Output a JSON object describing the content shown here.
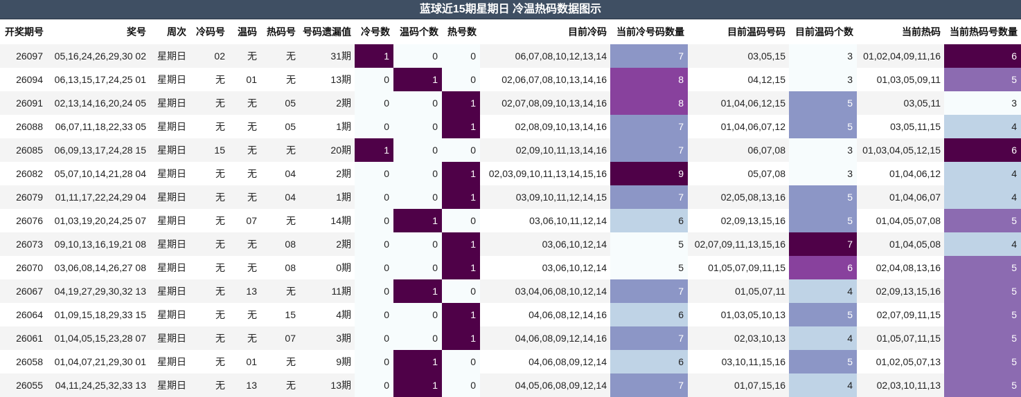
{
  "title": "蓝球近15期星期日 冷温热码数据图示",
  "headers": [
    "开奖期号",
    "奖号",
    "周次",
    "冷码号",
    "温码",
    "热码号",
    "号码遗漏值",
    "冷号数",
    "温码个数",
    "热号数",
    "目前冷码",
    "当前冷号码数量",
    "目前温码号码",
    "目前温码个数",
    "当前热码",
    "当前热码号数量"
  ],
  "colors": {
    "dark": "#4f0148",
    "purple": "#88419d",
    "med": "#8c6bb1",
    "blue": "#8c96c6",
    "light": "#bfd3e6",
    "pale": "#f7fcfd",
    "title_bg": "#3f4f63"
  },
  "rows": [
    {
      "period": "26097",
      "numbers": "05,16,24,26,29,30 02",
      "weekday": "星期日",
      "cold": "02",
      "warm": "无",
      "hot": "无",
      "miss": "31期",
      "cold_n": "1",
      "warm_n": "0",
      "hot_n": "0",
      "cur_cold": "06,07,08,10,12,13,14",
      "cur_cold_n": "7",
      "cur_warm": "03,05,15",
      "cur_warm_n": "3",
      "cur_hot": "01,02,04,09,11,16",
      "cur_hot_n": "6"
    },
    {
      "period": "26094",
      "numbers": "06,13,15,17,24,25 01",
      "weekday": "星期日",
      "cold": "无",
      "warm": "01",
      "hot": "无",
      "miss": "13期",
      "cold_n": "0",
      "warm_n": "1",
      "hot_n": "0",
      "cur_cold": "02,06,07,08,10,13,14,16",
      "cur_cold_n": "8",
      "cur_warm": "04,12,15",
      "cur_warm_n": "3",
      "cur_hot": "01,03,05,09,11",
      "cur_hot_n": "5"
    },
    {
      "period": "26091",
      "numbers": "02,13,14,16,20,24 05",
      "weekday": "星期日",
      "cold": "无",
      "warm": "无",
      "hot": "05",
      "miss": "2期",
      "cold_n": "0",
      "warm_n": "0",
      "hot_n": "1",
      "cur_cold": "02,07,08,09,10,13,14,16",
      "cur_cold_n": "8",
      "cur_warm": "01,04,06,12,15",
      "cur_warm_n": "5",
      "cur_hot": "03,05,11",
      "cur_hot_n": "3"
    },
    {
      "period": "26088",
      "numbers": "06,07,11,18,22,33 05",
      "weekday": "星期日",
      "cold": "无",
      "warm": "无",
      "hot": "05",
      "miss": "1期",
      "cold_n": "0",
      "warm_n": "0",
      "hot_n": "1",
      "cur_cold": "02,08,09,10,13,14,16",
      "cur_cold_n": "7",
      "cur_warm": "01,04,06,07,12",
      "cur_warm_n": "5",
      "cur_hot": "03,05,11,15",
      "cur_hot_n": "4"
    },
    {
      "period": "26085",
      "numbers": "06,09,13,17,24,28 15",
      "weekday": "星期日",
      "cold": "15",
      "warm": "无",
      "hot": "无",
      "miss": "20期",
      "cold_n": "1",
      "warm_n": "0",
      "hot_n": "0",
      "cur_cold": "02,09,10,11,13,14,16",
      "cur_cold_n": "7",
      "cur_warm": "06,07,08",
      "cur_warm_n": "3",
      "cur_hot": "01,03,04,05,12,15",
      "cur_hot_n": "6"
    },
    {
      "period": "26082",
      "numbers": "05,07,10,14,21,28 04",
      "weekday": "星期日",
      "cold": "无",
      "warm": "无",
      "hot": "04",
      "miss": "2期",
      "cold_n": "0",
      "warm_n": "0",
      "hot_n": "1",
      "cur_cold": "02,03,09,10,11,13,14,15,16",
      "cur_cold_n": "9",
      "cur_warm": "05,07,08",
      "cur_warm_n": "3",
      "cur_hot": "01,04,06,12",
      "cur_hot_n": "4"
    },
    {
      "period": "26079",
      "numbers": "01,11,17,22,24,29 04",
      "weekday": "星期日",
      "cold": "无",
      "warm": "无",
      "hot": "04",
      "miss": "1期",
      "cold_n": "0",
      "warm_n": "0",
      "hot_n": "1",
      "cur_cold": "03,09,10,11,12,14,15",
      "cur_cold_n": "7",
      "cur_warm": "02,05,08,13,16",
      "cur_warm_n": "5",
      "cur_hot": "01,04,06,07",
      "cur_hot_n": "4"
    },
    {
      "period": "26076",
      "numbers": "01,03,19,20,24,25 07",
      "weekday": "星期日",
      "cold": "无",
      "warm": "07",
      "hot": "无",
      "miss": "14期",
      "cold_n": "0",
      "warm_n": "1",
      "hot_n": "0",
      "cur_cold": "03,06,10,11,12,14",
      "cur_cold_n": "6",
      "cur_warm": "02,09,13,15,16",
      "cur_warm_n": "5",
      "cur_hot": "01,04,05,07,08",
      "cur_hot_n": "5"
    },
    {
      "period": "26073",
      "numbers": "09,10,13,16,19,21 08",
      "weekday": "星期日",
      "cold": "无",
      "warm": "无",
      "hot": "08",
      "miss": "2期",
      "cold_n": "0",
      "warm_n": "0",
      "hot_n": "1",
      "cur_cold": "03,06,10,12,14",
      "cur_cold_n": "5",
      "cur_warm": "02,07,09,11,13,15,16",
      "cur_warm_n": "7",
      "cur_hot": "01,04,05,08",
      "cur_hot_n": "4"
    },
    {
      "period": "26070",
      "numbers": "03,06,08,14,26,27 08",
      "weekday": "星期日",
      "cold": "无",
      "warm": "无",
      "hot": "08",
      "miss": "0期",
      "cold_n": "0",
      "warm_n": "0",
      "hot_n": "1",
      "cur_cold": "03,06,10,12,14",
      "cur_cold_n": "5",
      "cur_warm": "01,05,07,09,11,15",
      "cur_warm_n": "6",
      "cur_hot": "02,04,08,13,16",
      "cur_hot_n": "5"
    },
    {
      "period": "26067",
      "numbers": "04,19,27,29,30,32 13",
      "weekday": "星期日",
      "cold": "无",
      "warm": "13",
      "hot": "无",
      "miss": "11期",
      "cold_n": "0",
      "warm_n": "1",
      "hot_n": "0",
      "cur_cold": "03,04,06,08,10,12,14",
      "cur_cold_n": "7",
      "cur_warm": "01,05,07,11",
      "cur_warm_n": "4",
      "cur_hot": "02,09,13,15,16",
      "cur_hot_n": "5"
    },
    {
      "period": "26064",
      "numbers": "01,09,15,18,29,33 15",
      "weekday": "星期日",
      "cold": "无",
      "warm": "无",
      "hot": "15",
      "miss": "4期",
      "cold_n": "0",
      "warm_n": "0",
      "hot_n": "1",
      "cur_cold": "04,06,08,12,14,16",
      "cur_cold_n": "6",
      "cur_warm": "01,03,05,10,13",
      "cur_warm_n": "5",
      "cur_hot": "02,07,09,11,15",
      "cur_hot_n": "5"
    },
    {
      "period": "26061",
      "numbers": "01,04,05,15,23,28 07",
      "weekday": "星期日",
      "cold": "无",
      "warm": "无",
      "hot": "07",
      "miss": "3期",
      "cold_n": "0",
      "warm_n": "0",
      "hot_n": "1",
      "cur_cold": "04,06,08,09,12,14,16",
      "cur_cold_n": "7",
      "cur_warm": "02,03,10,13",
      "cur_warm_n": "4",
      "cur_hot": "01,05,07,11,15",
      "cur_hot_n": "5"
    },
    {
      "period": "26058",
      "numbers": "01,04,07,21,29,30 01",
      "weekday": "星期日",
      "cold": "无",
      "warm": "01",
      "hot": "无",
      "miss": "9期",
      "cold_n": "0",
      "warm_n": "1",
      "hot_n": "0",
      "cur_cold": "04,06,08,09,12,14",
      "cur_cold_n": "6",
      "cur_warm": "03,10,11,15,16",
      "cur_warm_n": "5",
      "cur_hot": "01,02,05,07,13",
      "cur_hot_n": "5"
    },
    {
      "period": "26055",
      "numbers": "04,11,24,25,32,33 13",
      "weekday": "星期日",
      "cold": "无",
      "warm": "13",
      "hot": "无",
      "miss": "13期",
      "cold_n": "0",
      "warm_n": "1",
      "hot_n": "0",
      "cur_cold": "04,05,06,08,09,12,14",
      "cur_cold_n": "7",
      "cur_warm": "01,07,15,16",
      "cur_warm_n": "4",
      "cur_hot": "02,03,10,11,13",
      "cur_hot_n": "5"
    }
  ]
}
